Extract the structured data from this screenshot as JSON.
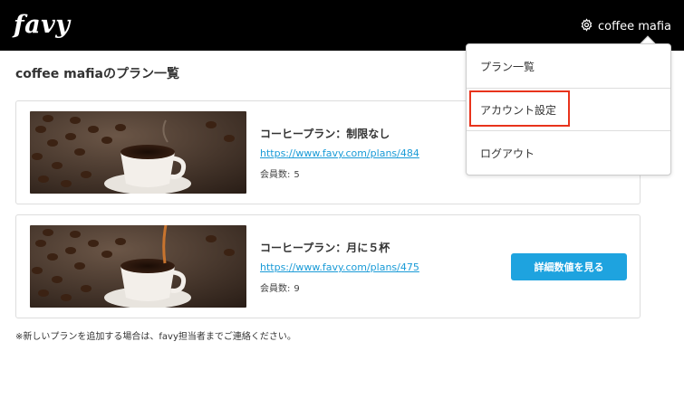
{
  "header": {
    "logo": "favy",
    "user_name": "coffee mafia"
  },
  "page": {
    "title": "coffee mafiaのプラン一覧"
  },
  "plans": [
    {
      "name": "コーヒープラン：制限なし",
      "url": "https://www.favy.com/plans/484",
      "members_label": "会員数:",
      "members_count": "5"
    },
    {
      "name": "コーヒープラン：月に５杯",
      "url": "https://www.favy.com/plans/475",
      "members_label": "会員数:",
      "members_count": "9",
      "details_button": "詳細数値を見る"
    }
  ],
  "footnote": "※新しいプランを追加する場合は、favy担当者までご連絡ください。",
  "dropdown": {
    "items": [
      {
        "label": "プラン一覧"
      },
      {
        "label": "アカウント設定",
        "highlighted": true
      },
      {
        "label": "ログアウト"
      }
    ]
  },
  "icons": {
    "settings": "gear-icon"
  },
  "colors": {
    "header_bg": "#000000",
    "link": "#1a9bd7",
    "button": "#1ea3df",
    "highlight": "#e8331c"
  }
}
